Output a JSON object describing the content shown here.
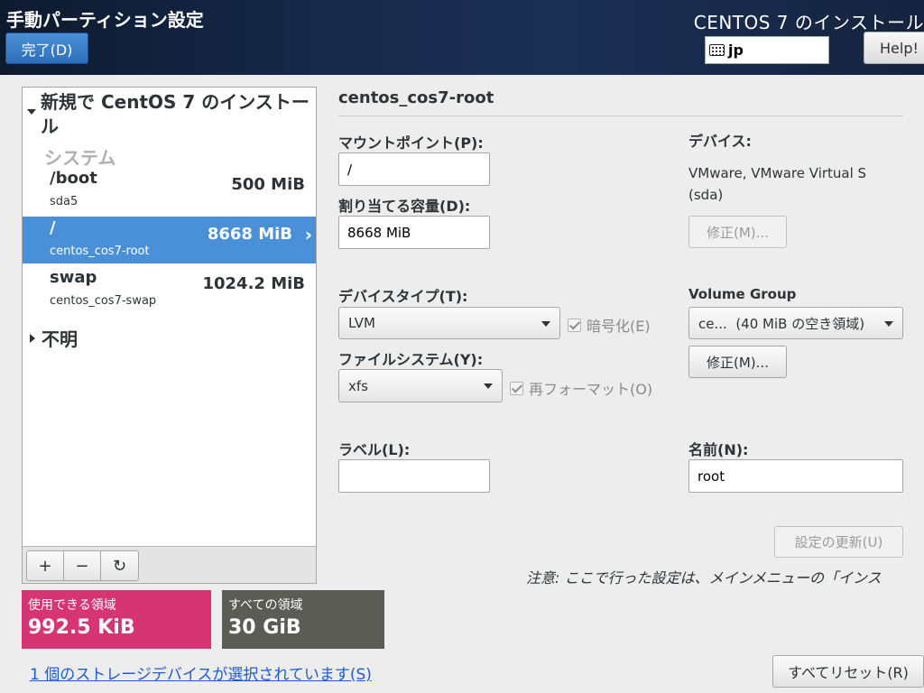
{
  "header": {
    "title": "手動パーティション設定",
    "done_label": "完了(D)",
    "installer_title": "CENTOS 7 のインストール",
    "keyboard_layout": "jp",
    "help_label": "Help!"
  },
  "left_panel": {
    "group_title": "新規で CentOS 7 のインストール",
    "subgroup": "システム",
    "mounts": [
      {
        "mount_point": "/boot",
        "device": "sda5",
        "size": "500 MiB",
        "selected": false
      },
      {
        "mount_point": "/",
        "device": "centos_cos7-root",
        "size": "8668 MiB",
        "selected": true
      },
      {
        "mount_point": "swap",
        "device": "centos_cos7-swap",
        "size": "1024.2 MiB",
        "selected": false
      }
    ],
    "unknown_label": "不明",
    "toolbar": {
      "add": "+",
      "remove": "−",
      "refresh": "↻"
    }
  },
  "space": {
    "available_label": "使用できる領域",
    "available_value": "992.5 KiB",
    "total_label": "すべての領域",
    "total_value": "30 GiB"
  },
  "storage_link": "1 個のストレージデバイスが選択されています(S)",
  "details": {
    "title": "centos_cos7-root",
    "mount_point_label": "マウントポイント(P):",
    "mount_point_value": "/",
    "capacity_label": "割り当てる容量(D):",
    "capacity_value": "8668 MiB",
    "device_label": "デバイス:",
    "device_value": "VMware, VMware Virtual S (sda)",
    "modify_device_label": "修正(M)...",
    "device_type_label": "デバイスタイプ(T):",
    "device_type_value": "LVM",
    "encrypt_label": "暗号化(E)",
    "volume_group_label": "Volume Group",
    "volume_group_value": "ce...  (40 MiB の空き領域)",
    "modify_vg_label": "修正(M)...",
    "filesystem_label": "ファイルシステム(Y):",
    "filesystem_value": "xfs",
    "reformat_label": "再フォーマット(O)",
    "label_label": "ラベル(L):",
    "label_value": "",
    "name_label": "名前(N):",
    "name_value": "root",
    "update_label": "設定の更新(U)",
    "note": "注意: ここで行った設定は、メインメニューの「インス",
    "reset_label": "すべてリセット(R)"
  },
  "colors": {
    "selected_row": "#4a90d9",
    "available_bg": "#d63473",
    "total_bg": "#5b5c55"
  }
}
